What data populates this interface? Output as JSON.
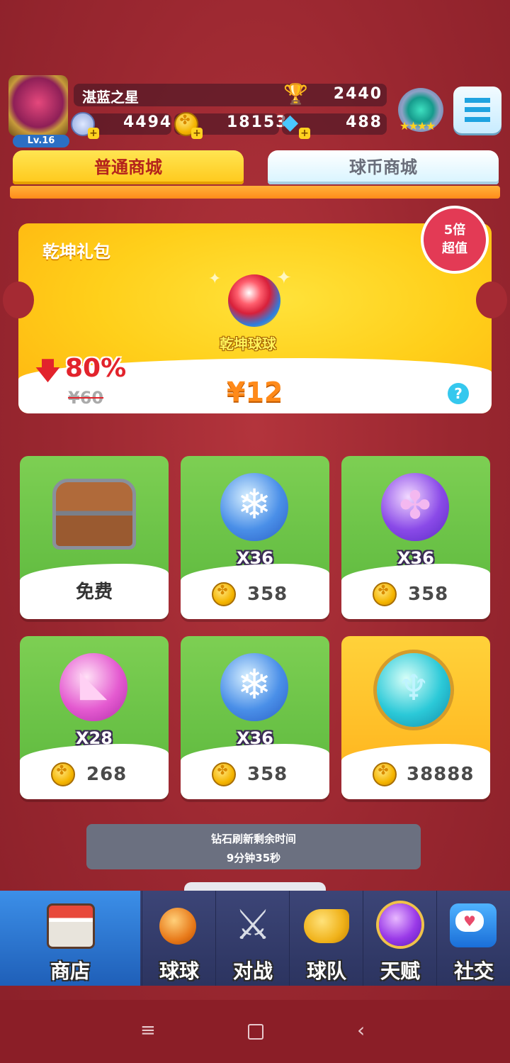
{
  "player": {
    "name": "湛蓝之星",
    "level": "Lv.16",
    "trophies": "2440",
    "stamina": "4494",
    "coins": "18153",
    "diamonds": "488"
  },
  "tabs": [
    {
      "label": "普通商城",
      "active": true
    },
    {
      "label": "球币商城",
      "active": false
    }
  ],
  "gift": {
    "title": "乾坤礼包",
    "badge_line1": "5倍",
    "badge_line2": "超值",
    "item_name": "乾坤球球",
    "discount": "80%",
    "old_price": "¥60",
    "price": "¥12",
    "help": "?"
  },
  "shop_items": [
    {
      "type": "chest",
      "label": "免费"
    },
    {
      "type": "snow",
      "qty": "X36",
      "price": "358"
    },
    {
      "type": "clover",
      "qty": "X36",
      "price": "358"
    },
    {
      "type": "pink",
      "qty": "X28",
      "price": "268"
    },
    {
      "type": "snow",
      "qty": "X36",
      "price": "358"
    },
    {
      "type": "cyan",
      "price": "38888"
    }
  ],
  "refresh": {
    "line1": "钻石刷新剩余时间",
    "line2": "9分钟35秒"
  },
  "nav": [
    {
      "label": "商店",
      "icon": "shop-icon",
      "active": true
    },
    {
      "label": "球球",
      "icon": "balls-icon"
    },
    {
      "label": "对战",
      "icon": "swords-icon"
    },
    {
      "label": "球队",
      "icon": "whistle-icon"
    },
    {
      "label": "天赋",
      "icon": "planet-icon"
    },
    {
      "label": "社交",
      "icon": "chat-icon"
    }
  ],
  "colors": {
    "background": "#9a2730",
    "active_tab": "#ffd21f",
    "card_green": "#6cc247",
    "card_gold": "#ffc42a",
    "nav_bg": "#343d6c",
    "nav_active": "#2a7ad6"
  }
}
